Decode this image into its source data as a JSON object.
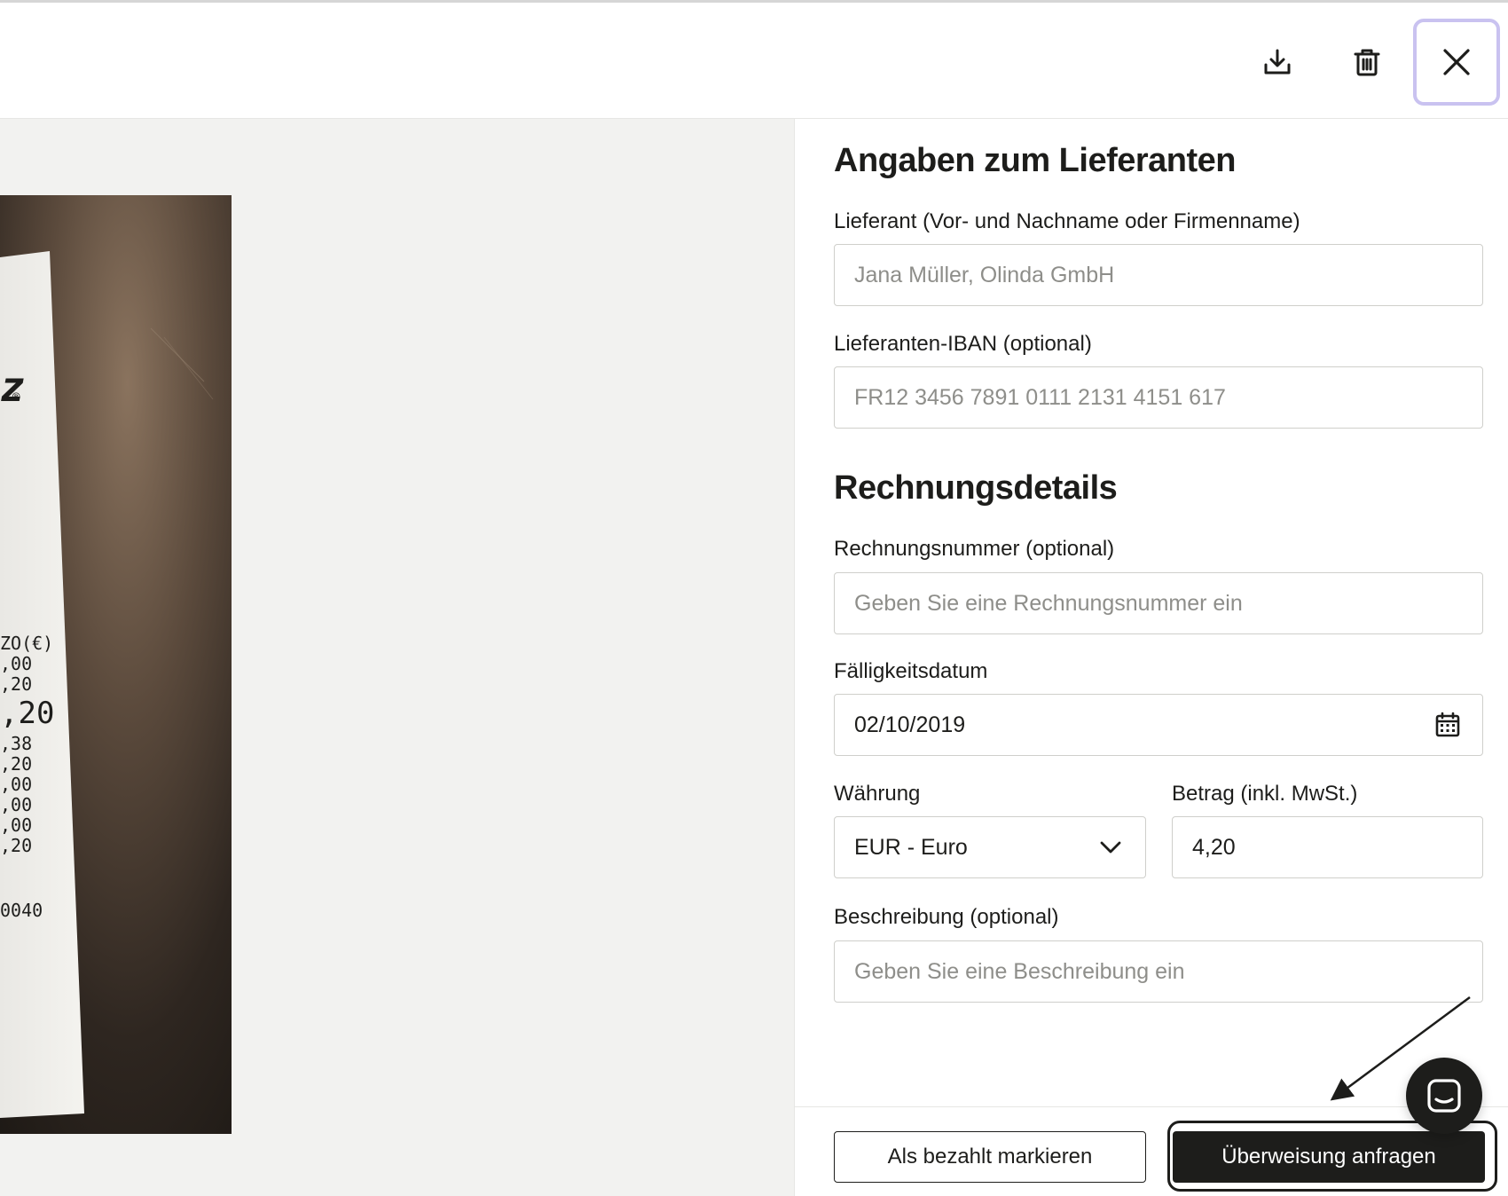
{
  "toolbar": {
    "download_icon": "download-icon",
    "delete_icon": "trash-icon",
    "close_icon": "close-icon"
  },
  "receipt": {
    "lines": [
      "ZO(€)",
      ",00",
      ",20",
      ",20",
      ",38",
      ",20",
      ",00",
      ",00",
      ",00",
      ",20",
      "0040"
    ],
    "mark": "z",
    "registered": "®"
  },
  "supplier_section": {
    "title": "Angaben zum Lieferanten",
    "supplier_label": "Lieferant (Vor- und Nachname oder Firmenname)",
    "supplier_placeholder": "Jana Müller, Olinda GmbH",
    "iban_label": "Lieferanten-IBAN (optional)",
    "iban_placeholder": "FR12 3456 7891 0111 2131 4151 617"
  },
  "invoice_section": {
    "title": "Rechnungsdetails",
    "number_label": "Rechnungsnummer (optional)",
    "number_placeholder": "Geben Sie eine Rechnungsnummer ein",
    "due_date_label": "Fälligkeitsdatum",
    "due_date_value": "02/10/2019",
    "currency_label": "Währung",
    "currency_value": "EUR - Euro",
    "amount_label": "Betrag (inkl. MwSt.)",
    "amount_value": "4,20",
    "description_label": "Beschreibung (optional)",
    "description_placeholder": "Geben Sie eine Beschreibung ein"
  },
  "footer": {
    "mark_paid_label": "Als bezahlt markieren",
    "request_transfer_label": "Überweisung anfragen"
  },
  "colors": {
    "text": "#1d1d1b",
    "placeholder": "#8e8e8a",
    "border": "#cfcfcb",
    "focus_ring": "#c9c2f0",
    "preview_bg": "#f2f2f0"
  }
}
